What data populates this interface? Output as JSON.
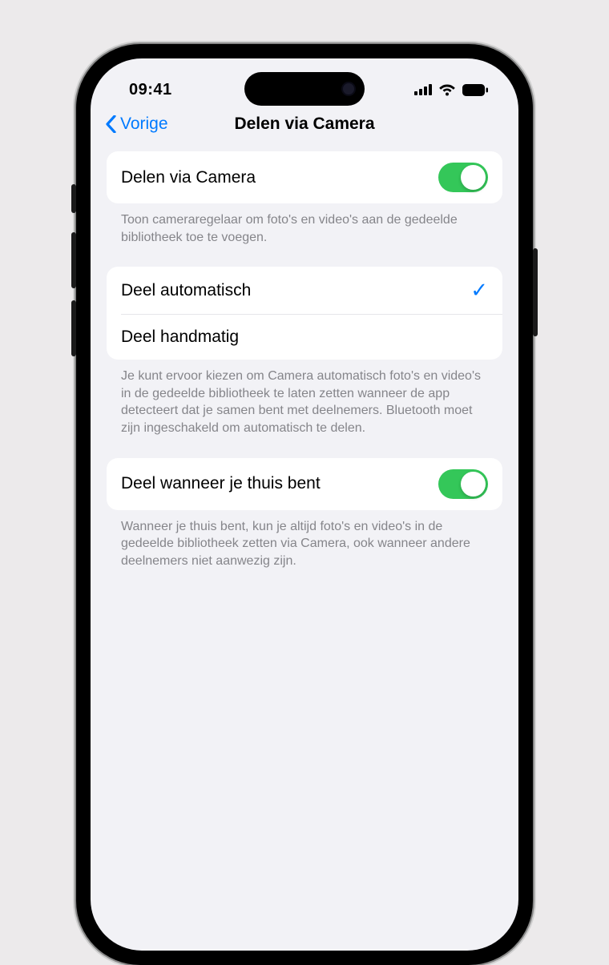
{
  "status": {
    "time": "09:41"
  },
  "nav": {
    "back": "Vorige",
    "title": "Delen via Camera"
  },
  "toggle1": {
    "label": "Delen via Camera",
    "footer": "Toon cameraregelaar om foto's en video's aan de gedeelde bibliotheek toe te voegen."
  },
  "options": {
    "auto": "Deel automatisch",
    "manual": "Deel handmatig",
    "footer": "Je kunt ervoor kiezen om Camera automatisch foto's en video's in de gedeelde bibliotheek te laten zetten wanneer de app detecteert dat je samen bent met deelnemers. Bluetooth moet zijn ingeschakeld om automatisch te delen."
  },
  "toggle2": {
    "label": "Deel wanneer je thuis bent",
    "footer": "Wanneer je thuis bent, kun je altijd foto's en video's in de gedeelde bibliotheek zetten via Camera, ook wanneer andere deelnemers niet aanwezig zijn."
  }
}
